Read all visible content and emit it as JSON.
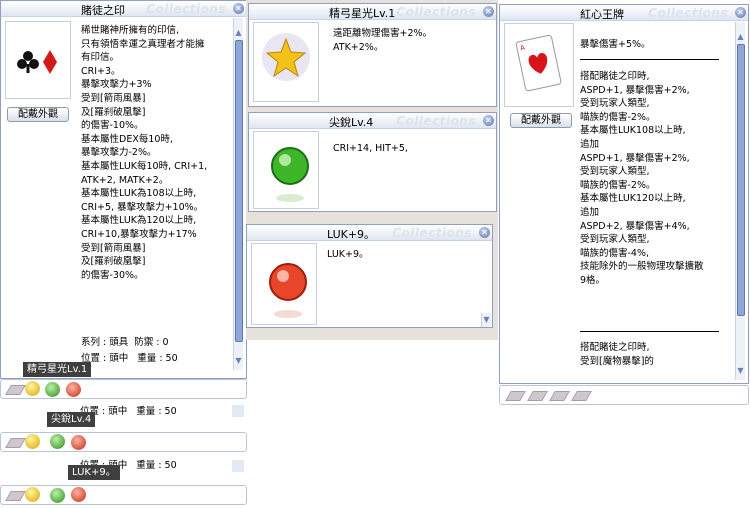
{
  "watermark": "Collections",
  "close_glyph": "✕",
  "win1": {
    "title": "賭徒之印",
    "button": "配戴外觀",
    "icon": "club-diamond-suits-icon",
    "lines": [
      "稀世賭神所擁有的印信,",
      "只有領悟幸運之真理者才能擁",
      "有印信。",
      "CRI+3。",
      "暴擊攻擊力+3%",
      "受到[箭雨風暴]",
      "及[羅刹破凰擊]",
      "的傷害-10%。",
      "基本屬性DEX每10時,",
      "暴擊攻擊力-2%。",
      "基本屬性LUK每10時, CRI+1,",
      "ATK+2, MATK+2。",
      "基本屬性LUK為108以上時,",
      "CRI+5, 暴擊攻擊力+10%。",
      "基本屬性LUK為120以上時,",
      "CRI+10,暴擊攻擊力+17%",
      "受到[箭雨風暴]",
      "及[羅刹破凰擊]",
      "的傷害-30%。"
    ],
    "row_type": "系列 : 頭具  防禦 : 0",
    "row_pos": "位置 : 頭中   重量 : 50"
  },
  "win2": {
    "title": "精弓星光Lv.1",
    "icon": "star-orb-icon",
    "lines": [
      "遠距離物理傷害+2%。",
      "ATK+2%。"
    ]
  },
  "win3": {
    "title": "尖銳Lv.4",
    "icon": "green-orb-icon",
    "lines": [
      "CRI+14, HIT+5,"
    ]
  },
  "win4": {
    "title": "LUK+9。",
    "icon": "red-orb-icon",
    "lines": [
      "LUK+9。"
    ]
  },
  "win5": {
    "title": "紅心王牌",
    "button": "配戴外觀",
    "icon": "heart-card-icon",
    "lines_a": [
      "暴擊傷害+5%。"
    ],
    "lines_b": [
      "搭配賭徒之印時,",
      "ASPD+1, 暴擊傷害+2%,",
      "受到玩家人類型,",
      "喵族的傷害-2%。",
      "基本屬性LUK108以上時,",
      "追加",
      "ASPD+1, 暴擊傷害+2%,",
      "受到玩家人類型,",
      "喵族的傷害-2%。",
      "基本屬性LUK120以上時,",
      "追加",
      "ASPD+2, 暴擊傷害+4%,",
      "受到玩家人類型,",
      "喵族的傷害-4%,",
      "技能除外的一般物理攻擊擴散",
      "9格。"
    ],
    "lines_c": [
      "搭配賭徒之印時,",
      "受到[魔物暴擊]的"
    ]
  },
  "tooltips": {
    "t1": "精弓星光Lv.1",
    "t2": "尖銳Lv.4",
    "t3": "LUK+9。"
  },
  "frag_row2": "位置 : 頭中   重量 : 50",
  "frag_row3": "位置 : 頭中   重量 : 50"
}
